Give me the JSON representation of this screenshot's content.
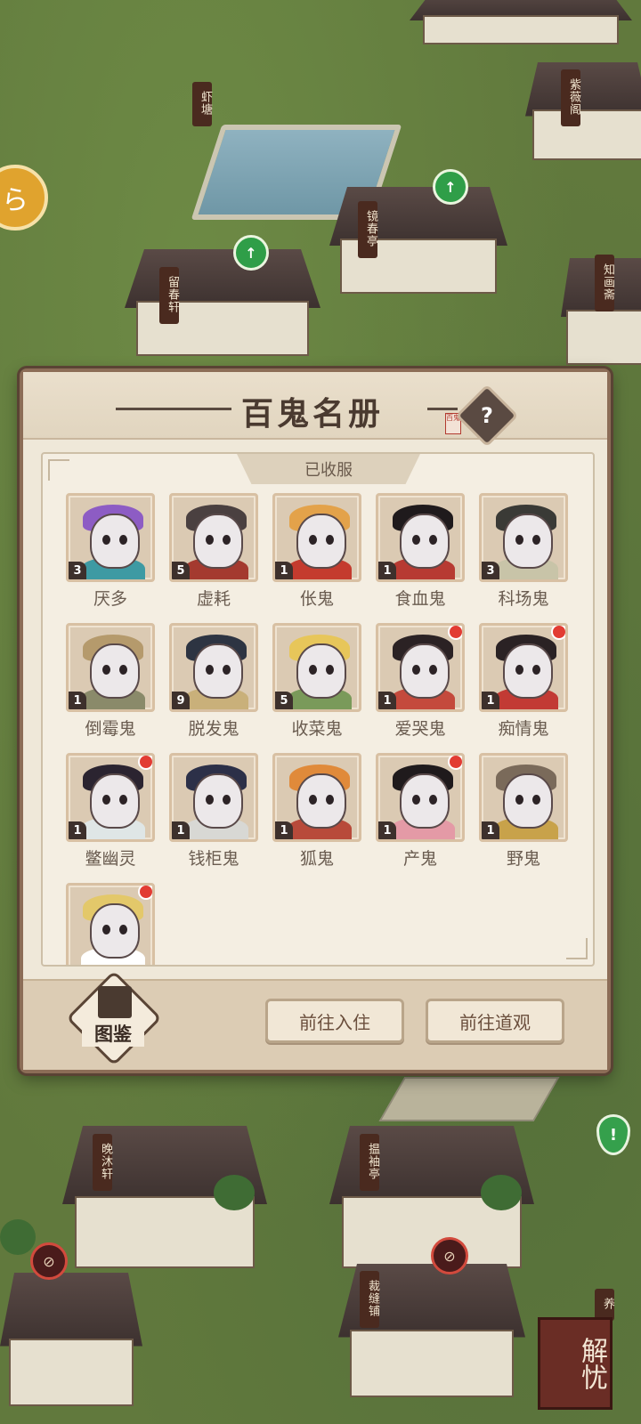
{
  "map": {
    "buildings": [
      {
        "name": "虾塘"
      },
      {
        "name": "紫薇阁"
      },
      {
        "name": "镜春亭"
      },
      {
        "name": "留春轩"
      },
      {
        "name": "知画斋"
      },
      {
        "name": "晚沐轩"
      },
      {
        "name": "揾袖亭"
      },
      {
        "name": "裁缝铺"
      },
      {
        "name": "养"
      }
    ],
    "corner_button": "解忧"
  },
  "panel": {
    "title": "百鬼名册",
    "seal_text": "百鬼",
    "help_icon": "?",
    "section_label": "已收服",
    "ghosts": [
      {
        "name": "厌多",
        "count": "3",
        "new": false,
        "hair": "#8d5cc4",
        "body": "#3e9aa3"
      },
      {
        "name": "虚耗",
        "count": "5",
        "new": false,
        "hair": "#4a4040",
        "body": "#a43a2f"
      },
      {
        "name": "伥鬼",
        "count": "1",
        "new": false,
        "hair": "#e3a24a",
        "body": "#c43b2e"
      },
      {
        "name": "食血鬼",
        "count": "1",
        "new": false,
        "hair": "#1f1a1c",
        "body": "#b73a32"
      },
      {
        "name": "科场鬼",
        "count": "3",
        "new": false,
        "hair": "#3a3a36",
        "body": "#c8c4a8"
      },
      {
        "name": "倒霉鬼",
        "count": "1",
        "new": false,
        "hair": "#b59a6c",
        "body": "#8a8a6a"
      },
      {
        "name": "脱发鬼",
        "count": "9",
        "new": false,
        "hair": "#2d3442",
        "body": "#c9b07a"
      },
      {
        "name": "收菜鬼",
        "count": "5",
        "new": false,
        "hair": "#e7c65a",
        "body": "#7a9a5a"
      },
      {
        "name": "爱哭鬼",
        "count": "1",
        "new": true,
        "hair": "#2b2224",
        "body": "#c44a3c"
      },
      {
        "name": "痴情鬼",
        "count": "1",
        "new": true,
        "hair": "#2a2224",
        "body": "#c23a34"
      },
      {
        "name": "鳖幽灵",
        "count": "1",
        "new": true,
        "hair": "#2b2430",
        "body": "#dfe6e6"
      },
      {
        "name": "钱柜鬼",
        "count": "1",
        "new": false,
        "hair": "#2c3048",
        "body": "#d8d8d4"
      },
      {
        "name": "狐鬼",
        "count": "1",
        "new": false,
        "hair": "#e08a3a",
        "body": "#b84a3a"
      },
      {
        "name": "产鬼",
        "count": "1",
        "new": true,
        "hair": "#1f1a1c",
        "body": "#e49aa6"
      },
      {
        "name": "野鬼",
        "count": "1",
        "new": false,
        "hair": "#7a6a5a",
        "body": "#c8a24a"
      },
      {
        "name": "",
        "count": "",
        "new": true,
        "hair": "#e3c86a",
        "body": "#ffffff"
      }
    ],
    "tujian_label": "图鉴",
    "buttons": {
      "go_stay": "前往入住",
      "go_temple": "前往道观"
    }
  },
  "colors": {
    "panel_bg": "#efe8d9",
    "panel_border": "#8c6d57",
    "new_dot": "#e23c33"
  }
}
